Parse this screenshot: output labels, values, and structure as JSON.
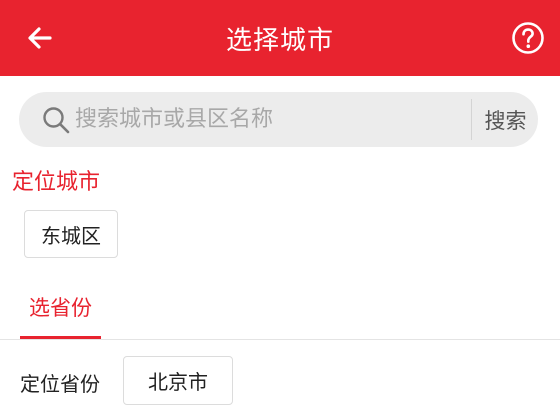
{
  "header": {
    "title": "选择城市",
    "back_icon": "back-arrow-icon",
    "help_icon": "help-circle-icon"
  },
  "search": {
    "placeholder": "搜索城市或县区名称",
    "value": "",
    "button_label": "搜索",
    "icon": "search-icon"
  },
  "located_city": {
    "title": "定位城市",
    "city": "东城区"
  },
  "tabs": [
    {
      "label": "选省份",
      "active": true
    }
  ],
  "province": {
    "label": "定位省份",
    "value": "北京市"
  },
  "colors": {
    "brand": "#e8232f",
    "search_bg": "#ececec",
    "placeholder": "#a8a8a8"
  }
}
